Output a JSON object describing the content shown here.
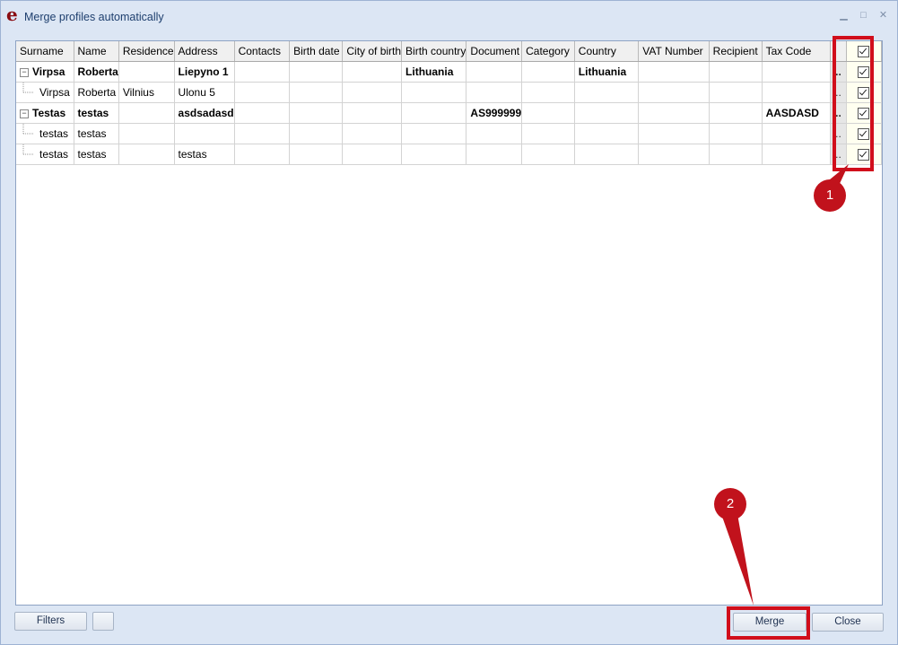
{
  "window": {
    "title": "Merge profiles automatically"
  },
  "columns": [
    "Surname",
    "Name",
    "Residence",
    "Address",
    "Contacts",
    "Birth date",
    "City of birth",
    "Birth country",
    "Document",
    "Category",
    "Country",
    "VAT Number",
    "Recipient",
    "Tax Code",
    "",
    ""
  ],
  "rows": [
    {
      "type": "parent",
      "cells": [
        "Virpsa",
        "Roberta",
        "",
        "Liepyno 1",
        "",
        "",
        "",
        "Lithuania",
        "",
        "",
        "Lithuania",
        "",
        "",
        ""
      ],
      "ellipsis": "..",
      "checked": true
    },
    {
      "type": "child",
      "cells": [
        "Virpsa",
        "Roberta",
        "Vilnius",
        "Ulonu 5",
        "",
        "",
        "",
        "",
        "",
        "",
        "",
        "",
        "",
        ""
      ],
      "ellipsis": "..",
      "checked": true
    },
    {
      "type": "parent",
      "cells": [
        "Testas",
        "testas",
        "",
        "asdsadasd",
        "",
        "",
        "",
        "",
        "AS999999",
        "",
        "",
        "",
        "",
        "AASDASD"
      ],
      "ellipsis": "..",
      "checked": true
    },
    {
      "type": "child",
      "cells": [
        "testas",
        "testas",
        "",
        "",
        "",
        "",
        "",
        "",
        "",
        "",
        "",
        "",
        "",
        ""
      ],
      "ellipsis": "..",
      "checked": true
    },
    {
      "type": "child",
      "cells": [
        "testas",
        "testas",
        "",
        "testas",
        "",
        "",
        "",
        "",
        "",
        "",
        "",
        "",
        "",
        ""
      ],
      "ellipsis": "..",
      "checked": true
    }
  ],
  "annotations": {
    "marker_1": "1",
    "marker_2": "2",
    "accent": "#d10e1b"
  },
  "footer": {
    "filters_label": "Filters",
    "blank_label": "",
    "merge_label": "Merge",
    "close_label": "Close"
  },
  "icons": {
    "app": "e",
    "minimize": "minimize-icon",
    "restore": "restore-icon",
    "close": "close-icon"
  }
}
